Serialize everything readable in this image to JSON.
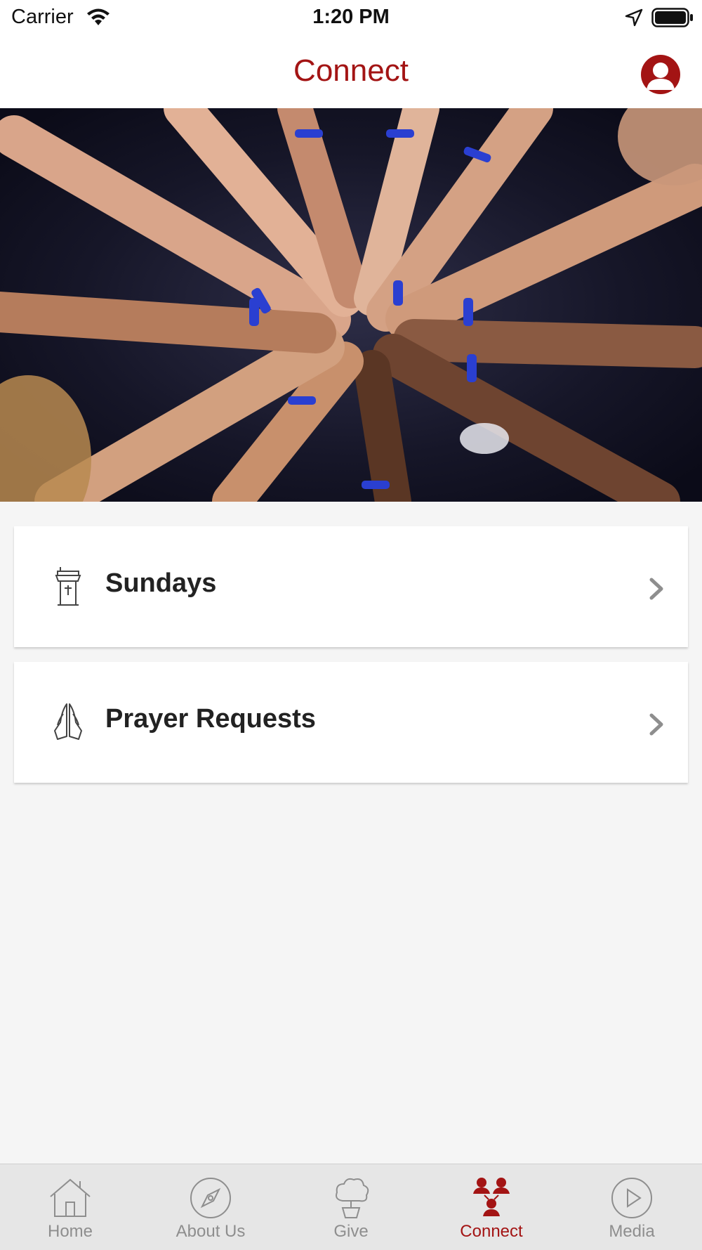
{
  "status_bar": {
    "carrier": "Carrier",
    "time": "1:20 PM",
    "wifi_icon": "wifi-icon",
    "location_icon": "location-arrow-icon",
    "battery_icon": "battery-full-icon"
  },
  "header": {
    "title": "Connect",
    "profile_icon": "user-profile-icon"
  },
  "hero": {
    "image": "photo of many hands stacked together in a circle"
  },
  "cards": [
    {
      "label": "Sundays",
      "icon": "pulpit-icon"
    },
    {
      "label": "Prayer Requests",
      "icon": "praying-hands-icon"
    }
  ],
  "tab_bar": {
    "tabs": [
      {
        "label": "Home",
        "icon": "home-icon",
        "active": false
      },
      {
        "label": "About Us",
        "icon": "compass-icon",
        "active": false
      },
      {
        "label": "Give",
        "icon": "give-tree-icon",
        "active": false
      },
      {
        "label": "Connect",
        "icon": "people-connect-icon",
        "active": true
      },
      {
        "label": "Media",
        "icon": "play-circle-icon",
        "active": false
      }
    ]
  },
  "colors": {
    "accent": "#a31414",
    "inactive": "#8e8e8e",
    "background": "#f5f5f5",
    "tab_bar_bg": "#e6e6e6"
  }
}
